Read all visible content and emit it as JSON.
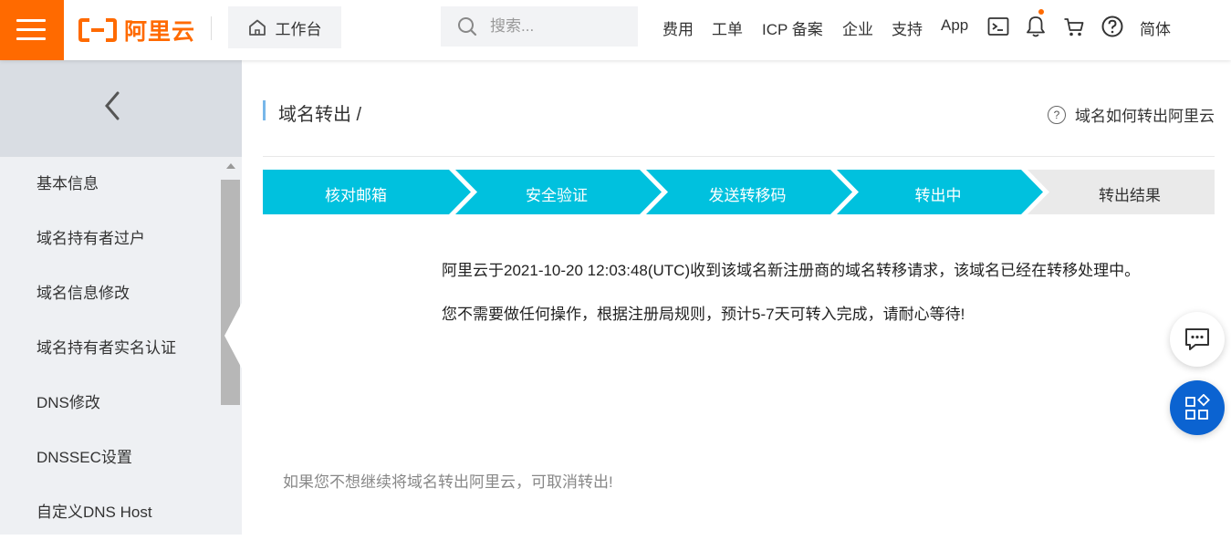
{
  "header": {
    "logo_text": "阿里云",
    "workbench_label": "工作台",
    "search_placeholder": "搜索...",
    "nav": {
      "billing": "费用",
      "ticket": "工单",
      "icp": "ICP 备案",
      "enterprise": "企业",
      "support": "支持",
      "app": "App",
      "language": "简体"
    },
    "accent_color": "#ff6a00"
  },
  "sidebar": {
    "items": [
      {
        "label": "基本信息"
      },
      {
        "label": "域名持有者过户"
      },
      {
        "label": "域名信息修改"
      },
      {
        "label": "域名持有者实名认证"
      },
      {
        "label": "DNS修改"
      },
      {
        "label": "DNSSEC设置"
      },
      {
        "label": "自定义DNS Host"
      }
    ]
  },
  "main": {
    "title": "域名转出 /",
    "help_link": "域名如何转出阿里云",
    "steps": [
      {
        "label": "核对邮箱",
        "state": "done"
      },
      {
        "label": "安全验证",
        "state": "done"
      },
      {
        "label": "发送转移码",
        "state": "done"
      },
      {
        "label": "转出中",
        "state": "active"
      },
      {
        "label": "转出结果",
        "state": "pending"
      }
    ],
    "step_active_color": "#00c1de",
    "step_pending_color": "#eaeaea",
    "message_line1": "阿里云于2021-10-20 12:03:48(UTC)收到该域名新注册商的域名转移请求，该域名已经在转移处理中。",
    "message_line2": "您不需要做任何操作，根据注册局规则，预计5-7天可转入完成，请耐心等待!",
    "cancel_note": "如果您不想继续将域名转出阿里云，可取消转出!"
  }
}
